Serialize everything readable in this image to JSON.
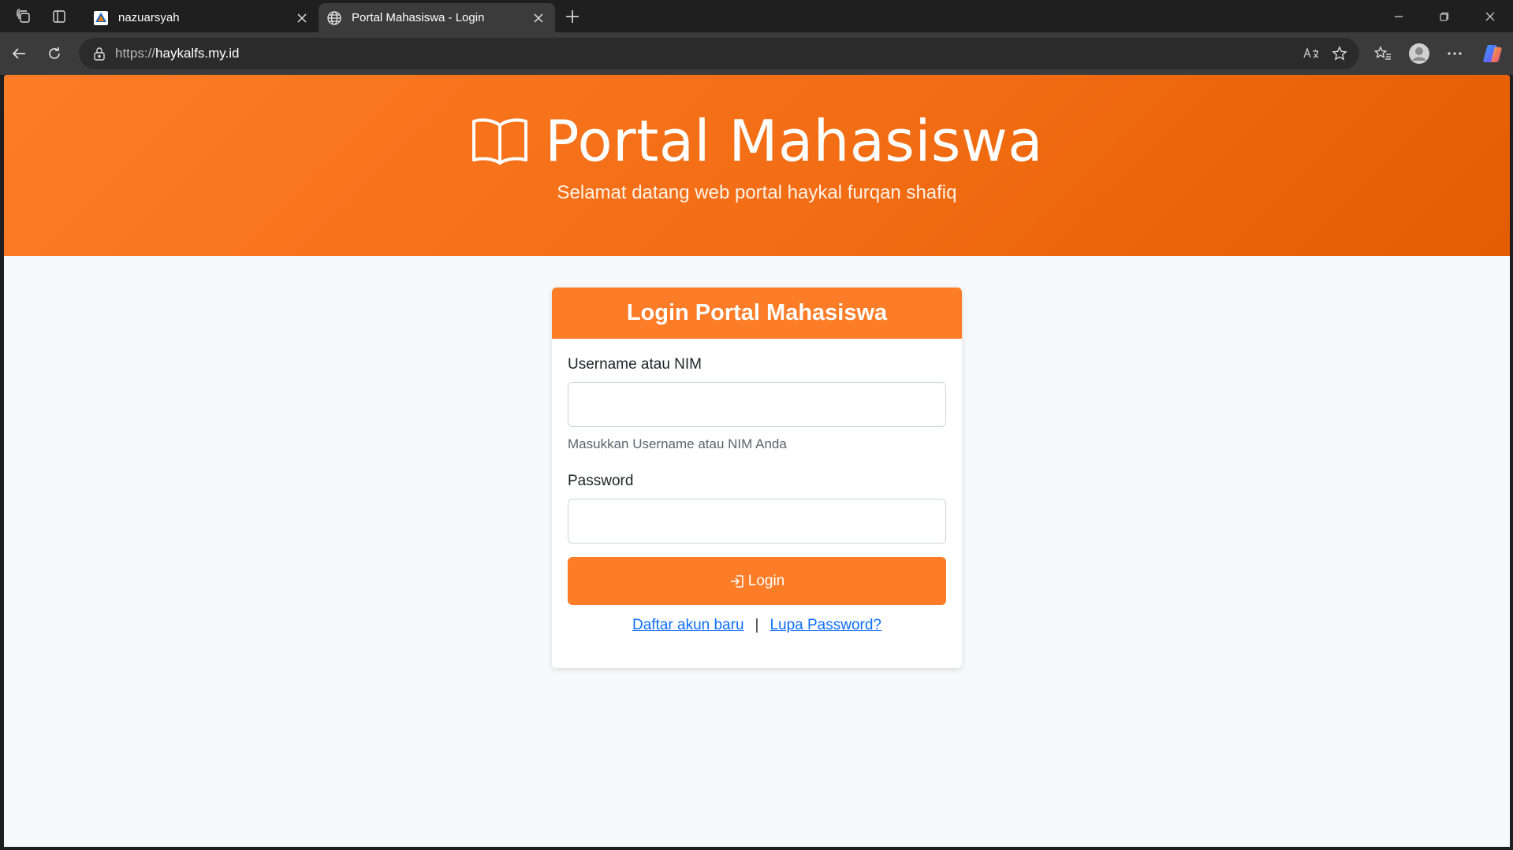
{
  "browser": {
    "tabs": [
      {
        "title": "nazuarsyah",
        "active": false
      },
      {
        "title": "Portal Mahasiswa - Login",
        "active": true
      }
    ],
    "url_scheme": "https://",
    "url_host": "haykalfs.my.id"
  },
  "page": {
    "hero": {
      "title": "Portal Mahasiswa",
      "subtitle": "Selamat datang web portal haykal furqan shafiq"
    },
    "login": {
      "header": "Login Portal Mahasiswa",
      "username_label": "Username atau NIM",
      "username_value": "",
      "username_help": "Masukkan Username atau NIM Anda",
      "password_label": "Password",
      "password_value": "",
      "submit_label": "Login",
      "register_link": "Daftar akun baru",
      "separator": "|",
      "forgot_link": "Lupa Password?"
    }
  },
  "colors": {
    "brand_orange": "#fd7c27",
    "link_blue": "#0d6efd",
    "page_bg": "#f8f9fa"
  }
}
